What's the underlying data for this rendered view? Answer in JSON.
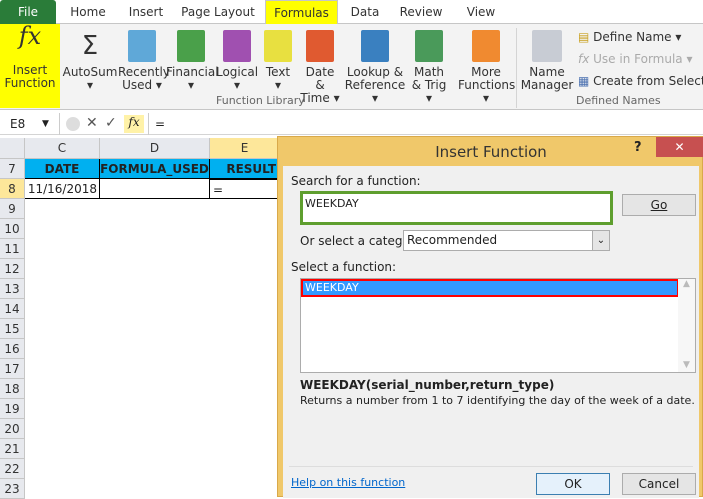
{
  "tabs": [
    "File",
    "Home",
    "Insert",
    "Page Layout",
    "Formulas",
    "Data",
    "Review",
    "View"
  ],
  "ribbon": {
    "insert_function": [
      "Insert",
      "Function"
    ],
    "buttons": [
      {
        "l1": "AutoSum",
        "l2": "▾",
        "icon": "sigma-icon",
        "color": "#333333"
      },
      {
        "l1": "Recently",
        "l2": "Used ▾",
        "icon": "star-book-icon",
        "color": "#5fa8d8"
      },
      {
        "l1": "Financial",
        "l2": "▾",
        "icon": "financial-book-icon",
        "color": "#4aa04a"
      },
      {
        "l1": "Logical",
        "l2": "▾",
        "icon": "logical-book-icon",
        "color": "#a050b0"
      },
      {
        "l1": "Text",
        "l2": "▾",
        "icon": "text-book-icon",
        "color": "#e8e040"
      },
      {
        "l1": "Date &",
        "l2": "Time ▾",
        "icon": "calendar-book-icon",
        "color": "#e05a30"
      },
      {
        "l1": "Lookup &",
        "l2": "Reference ▾",
        "icon": "lookup-book-icon",
        "color": "#3a80c0"
      },
      {
        "l1": "Math",
        "l2": "& Trig ▾",
        "icon": "theta-book-icon",
        "color": "#4a9a5a"
      },
      {
        "l1": "More",
        "l2": "Functions ▾",
        "icon": "more-books-icon",
        "color": "#f08a30"
      }
    ],
    "function_library": "Function Library",
    "name_manager": [
      "Name",
      "Manager"
    ],
    "define_name": "Define Name ▾",
    "use_in_formula": "Use in Formula ▾",
    "create_from_selection": "Create from Selection",
    "defined_names": "Defined Names"
  },
  "formula_bar": {
    "name_box": "E8",
    "content": "=",
    "fx": "fx"
  },
  "sheet": {
    "columns": [
      "C",
      "D",
      "E"
    ],
    "rows": [
      "7",
      "8",
      "9",
      "10",
      "11",
      "12",
      "13",
      "14",
      "15",
      "16",
      "17",
      "18",
      "19",
      "20",
      "21",
      "22",
      "23"
    ],
    "headers": [
      "DATE",
      "FORMULA_USED",
      "RESULT"
    ],
    "row8": [
      "11/16/2018",
      "",
      "="
    ]
  },
  "dialog": {
    "title": "Insert Function",
    "help": "?",
    "close": "✕",
    "search_label": "Search for a function:",
    "search_value": "WEEKDAY",
    "go": "Go",
    "category_label": "Or select a category:",
    "category_value": "Recommended",
    "select_label": "Select a function:",
    "functions": [
      "WEEKDAY"
    ],
    "signature": "WEEKDAY(serial_number,return_type)",
    "description": "Returns a number from 1 to 7 identifying the day of the week of a date.",
    "help_link": "Help on this function",
    "ok": "OK",
    "cancel": "Cancel"
  }
}
